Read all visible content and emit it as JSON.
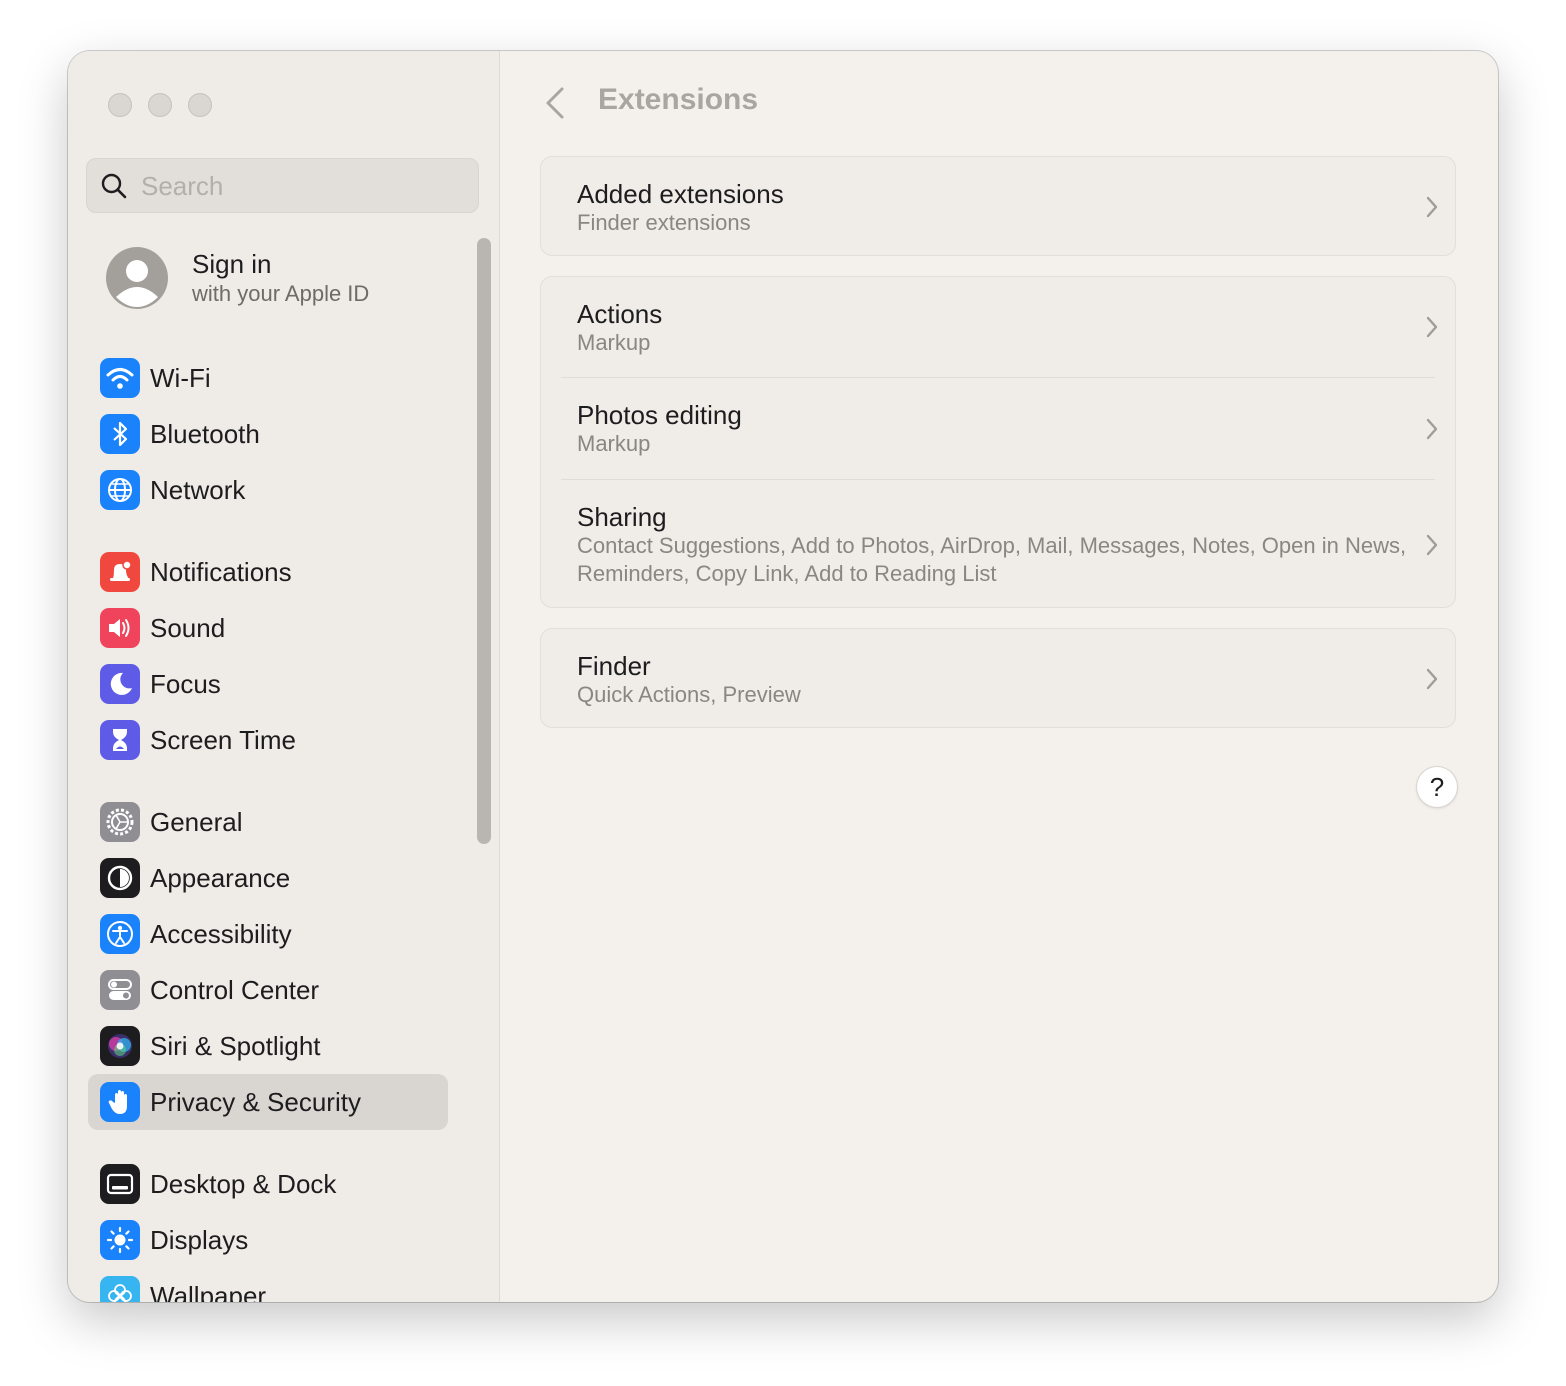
{
  "search": {
    "placeholder": "Search"
  },
  "account": {
    "title": "Sign in",
    "subtitle": "with your Apple ID"
  },
  "sidebar": {
    "items": [
      {
        "label": "Wi-Fi",
        "icon": "wifi-icon",
        "color": "#1a82fb"
      },
      {
        "label": "Bluetooth",
        "icon": "bluetooth-icon",
        "color": "#1a82fb"
      },
      {
        "label": "Network",
        "icon": "globe-icon",
        "color": "#1a82fb"
      },
      {
        "label": "Notifications",
        "icon": "bell-icon",
        "color": "#f0483e"
      },
      {
        "label": "Sound",
        "icon": "speaker-icon",
        "color": "#f0445d"
      },
      {
        "label": "Focus",
        "icon": "moon-icon",
        "color": "#5e5ce6"
      },
      {
        "label": "Screen Time",
        "icon": "hourglass-icon",
        "color": "#5e5ce6"
      },
      {
        "label": "General",
        "icon": "gear-icon",
        "color": "#8e8e93"
      },
      {
        "label": "Appearance",
        "icon": "appearance-icon",
        "color": "#1d1d1f"
      },
      {
        "label": "Accessibility",
        "icon": "accessibility-icon",
        "color": "#1a82fb"
      },
      {
        "label": "Control Center",
        "icon": "toggles-icon",
        "color": "#8e8e93"
      },
      {
        "label": "Siri & Spotlight",
        "icon": "siri-icon",
        "color": "#1d1d1f"
      },
      {
        "label": "Privacy & Security",
        "icon": "hand-icon",
        "color": "#1a82fb",
        "selected": true
      },
      {
        "label": "Desktop & Dock",
        "icon": "dock-icon",
        "color": "#1d1d1f"
      },
      {
        "label": "Displays",
        "icon": "sun-icon",
        "color": "#1a82fb"
      },
      {
        "label": "Wallpaper",
        "icon": "flower-icon",
        "color": "#37b5f0"
      }
    ]
  },
  "main": {
    "title": "Extensions",
    "groups": [
      {
        "rows": [
          {
            "title": "Added extensions",
            "subtitle": "Finder extensions"
          }
        ]
      },
      {
        "rows": [
          {
            "title": "Actions",
            "subtitle": "Markup"
          },
          {
            "title": "Photos editing",
            "subtitle": "Markup"
          },
          {
            "title": "Sharing",
            "subtitle": "Contact Suggestions, Add to Photos, AirDrop, Mail, Messages, Notes, Open in News, Reminders, Copy Link, Add to Reading List"
          }
        ]
      },
      {
        "rows": [
          {
            "title": "Finder",
            "subtitle": "Quick Actions, Preview"
          }
        ]
      }
    ],
    "help_label": "?"
  }
}
